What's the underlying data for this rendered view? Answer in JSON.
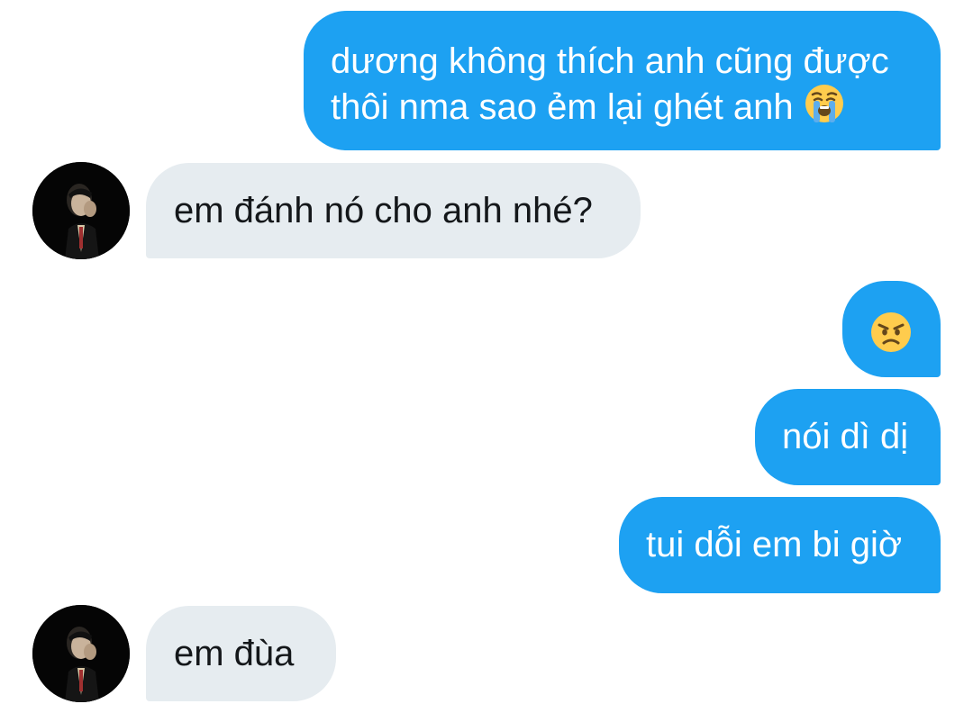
{
  "messages": [
    {
      "direction": "outgoing",
      "lines": [
        "dương không thích anh cũng được",
        "thôi nma sao ẻm lại ghét anh"
      ],
      "emoji": "loudly-crying-face-icon"
    },
    {
      "direction": "incoming",
      "text": "em đánh nó cho anh nhé?"
    },
    {
      "direction": "outgoing",
      "emoji": "angry-face-icon"
    },
    {
      "direction": "outgoing",
      "text": "nói dì dị"
    },
    {
      "direction": "outgoing",
      "text": "tui dỗi em bi giờ"
    },
    {
      "direction": "incoming",
      "text": "em đùa"
    }
  ],
  "colors": {
    "outgoing_bubble": "#1da1f2",
    "incoming_bubble": "#e6ecf0",
    "outgoing_text": "#ffffff",
    "incoming_text": "#14171a"
  }
}
